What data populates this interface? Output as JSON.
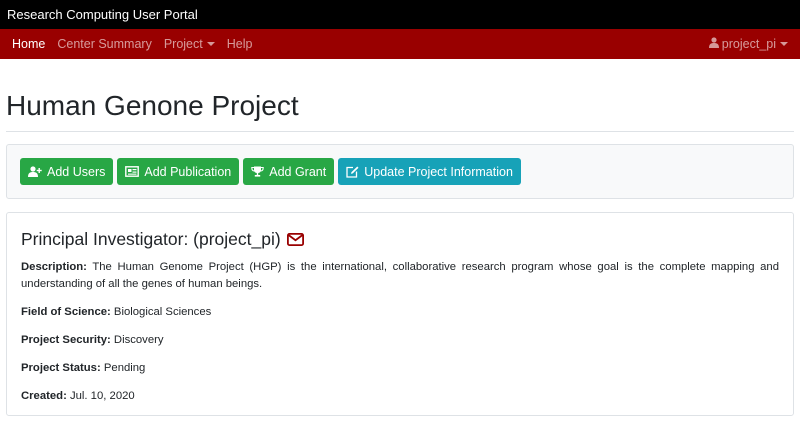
{
  "app": {
    "title": "Research Computing User Portal"
  },
  "nav": {
    "items": [
      {
        "label": "Home",
        "active": true
      },
      {
        "label": "Center Summary",
        "active": false
      },
      {
        "label": "Project",
        "active": false,
        "dropdown": true
      },
      {
        "label": "Help",
        "active": false
      }
    ],
    "user": "project_pi"
  },
  "page": {
    "title": "Human Genone Project"
  },
  "actions": {
    "add_users": "Add Users",
    "add_publication": "Add Publication",
    "add_grant": "Add Grant",
    "update_project": "Update Project Information"
  },
  "project": {
    "pi_heading": "Principal Investigator: (project_pi)",
    "description_label": "Description:",
    "description": "The Human Genome Project (HGP) is the international, collaborative research program whose goal is the complete mapping and understanding of all the genes of human beings.",
    "field_label": "Field of Science:",
    "field": "Biological Sciences",
    "security_label": "Project Security:",
    "security": "Discovery",
    "status_label": "Project Status:",
    "status": "Pending",
    "created_label": "Created:",
    "created": "Jul. 10, 2020"
  },
  "colors": {
    "navbar": "#990000",
    "success": "#28a745",
    "info": "#17a2b8",
    "mail_icon": "#990000"
  },
  "icons": [
    "user-plus-icon",
    "publication-icon",
    "trophy-icon",
    "edit-icon",
    "envelope-icon",
    "user-icon"
  ]
}
